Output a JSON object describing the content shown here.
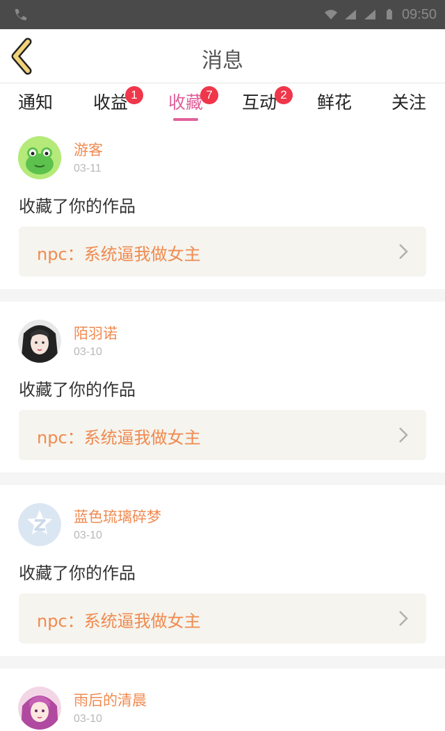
{
  "status_bar": {
    "time": "09:50"
  },
  "header": {
    "title": "消息"
  },
  "tabs": [
    {
      "label": "通知",
      "badge": null
    },
    {
      "label": "收益",
      "badge": "1"
    },
    {
      "label": "收藏",
      "badge": "7",
      "active": true
    },
    {
      "label": "互动",
      "badge": "2"
    },
    {
      "label": "鲜花",
      "badge": null
    },
    {
      "label": "关注",
      "badge": null
    }
  ],
  "messages": [
    {
      "user": "游客",
      "date": "03-11",
      "action": "收藏了你的作品",
      "work_title": "npc：系统逼我做女主",
      "avatar": "frog"
    },
    {
      "user": "陌羽诺",
      "date": "03-10",
      "action": "收藏了你的作品",
      "work_title": "npc：系统逼我做女主",
      "avatar": "girl-dark"
    },
    {
      "user": "蓝色琉璃碎梦",
      "date": "03-10",
      "action": "收藏了你的作品",
      "work_title": "npc：系统逼我做女主",
      "avatar": "default-z"
    },
    {
      "user": "雨后的清晨",
      "date": "03-10",
      "action": "",
      "work_title": "",
      "avatar": "girl-pink"
    }
  ],
  "colors": {
    "accent_pink": "#e0609a",
    "name_orange": "#f08a50",
    "badge_red": "#f0364a",
    "status_bar": "#4a4a4a",
    "card_bg": "#f5f4ee"
  },
  "icons": [
    "back-chevron-icon",
    "chevron-right-icon",
    "wifi-icon",
    "signal-icon",
    "battery-icon",
    "phone-icon"
  ]
}
